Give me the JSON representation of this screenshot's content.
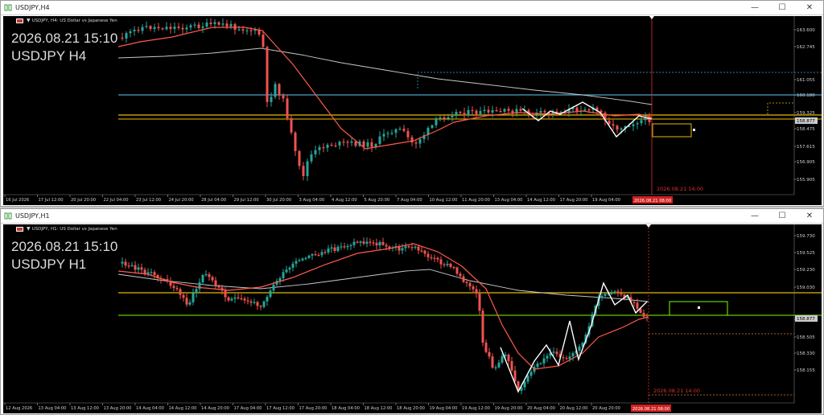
{
  "windows": [
    {
      "title": "USDJPY,H4",
      "subtitle": "USDJPY, H4:  US Dollar vs Japanese Yen",
      "overlay_time": "2026.08.21 15:10",
      "overlay_symbol": "USDJPY H4",
      "price_labels": [
        "163.600",
        "162.745",
        "161.055",
        "160.180",
        "159.325",
        "158.877",
        "158.475",
        "157.615",
        "156.905",
        "155.905"
      ],
      "current_price": "158.877",
      "time_labels": [
        "16 Jul 2026",
        "17 Jul 12:00",
        "20 Jul 20:00",
        "22 Jul 04:00",
        "23 Jul 12:00",
        "24 Jul 20:00",
        "28 Jul 04:00",
        "29 Jul 12:00",
        "30 Jul 20:00",
        "3 Aug 04:00",
        "4 Aug 12:00",
        "5 Aug 20:00",
        "7 Aug 04:00",
        "10 Aug 12:00",
        "11 Aug 20:00",
        "13 Aug 04:00",
        "14 Aug 12:00",
        "17 Aug 20:00",
        "19 Aug 04:00"
      ],
      "cursor_time": "2026.08.21 08:00",
      "vline_label": "2026.08.21 14:00"
    },
    {
      "title": "USDJPY,H1",
      "subtitle": "USDJPY, H1:  US Dollar vs Japanese Yen",
      "overlay_time": "2026.08.21 15:10",
      "overlay_symbol": "USDJPY H1",
      "price_labels": [
        "159.730",
        "159.525",
        "159.230",
        "159.030",
        "158.877",
        "158.700",
        "158.505",
        "158.330",
        "158.155"
      ],
      "current_price": "158.877",
      "time_labels": [
        "12 Aug 2026",
        "13 Aug 04:00",
        "13 Aug 12:00",
        "13 Aug 20:00",
        "14 Aug 04:00",
        "14 Aug 12:00",
        "14 Aug 20:00",
        "17 Aug 04:00",
        "17 Aug 12:00",
        "17 Aug 20:00",
        "18 Aug 04:00",
        "18 Aug 12:00",
        "18 Aug 20:00",
        "19 Aug 04:00",
        "19 Aug 12:00",
        "19 Aug 20:00",
        "20 Aug 04:00",
        "20 Aug 12:00",
        "20 Aug 20:00"
      ],
      "cursor_time": "2026.08.21 08:00",
      "vline_label": "2026.08.21 14:00"
    }
  ],
  "colors": {
    "bull": "#26a69a",
    "bear": "#ef5350",
    "bg": "#000000",
    "ema_fast": "#ff5a4a",
    "ma_slow": "#c8c8c8",
    "level_yellow": "#e6b800",
    "level_blue": "#4aa3c8",
    "level_green": "#7cfc00",
    "zigzag": "#ffffff",
    "cursor": "#e03030"
  },
  "icons": {
    "app": "chart-window-icon",
    "min": "minimize-icon",
    "max": "maximize-icon",
    "close": "close-icon"
  }
}
